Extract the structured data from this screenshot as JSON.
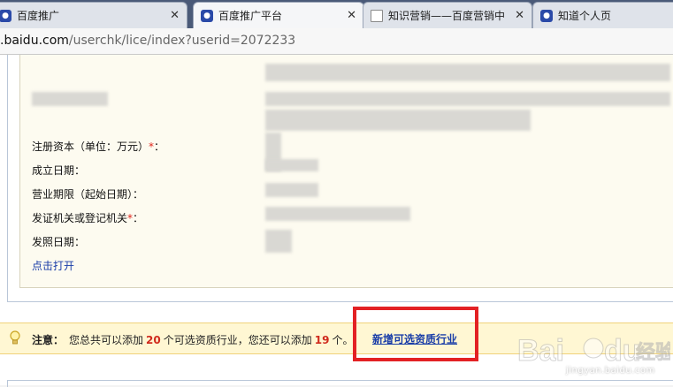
{
  "browser": {
    "tabs": [
      {
        "title": "百度推广",
        "icon": "baidu-paw-icon",
        "active": false
      },
      {
        "title": "百度推广平台",
        "icon": "baidu-paw-icon",
        "active": true
      },
      {
        "title": "知识营销——百度营销中",
        "icon": "document-icon",
        "active": false
      },
      {
        "title": "知道个人页",
        "icon": "baidu-paw-icon",
        "active": false
      }
    ],
    "close_glyph": "✕",
    "address": {
      "host": ".baidu.com",
      "path": "/userchk/lice/index?userid=2072233"
    }
  },
  "form": {
    "fields": [
      {
        "label": "注册资本（单位：万元）",
        "required_mark": "*",
        "suffix": "："
      },
      {
        "label": "成立日期："
      },
      {
        "label": "营业期限（起始日期）："
      },
      {
        "label": "发证机关或登记机关",
        "required_mark": "*",
        "suffix": "："
      },
      {
        "label": "发照日期："
      }
    ],
    "open_link": "点击打开"
  },
  "notice": {
    "prefix": "注意：",
    "text_1": "您总共可以添加",
    "total": "20",
    "text_2": "个可选资质行业，您还可以添加",
    "remaining": "19",
    "text_3": "个。",
    "add_link": "新增可选资质行业"
  },
  "watermark": {
    "brand": "Bai",
    "brand2": "du",
    "cn": "经验",
    "sub": "jingyan.baidu.com"
  },
  "colors": {
    "accent_red": "#e32124",
    "link_blue": "#1a3ea8",
    "notice_bg": "#fff7d3"
  }
}
